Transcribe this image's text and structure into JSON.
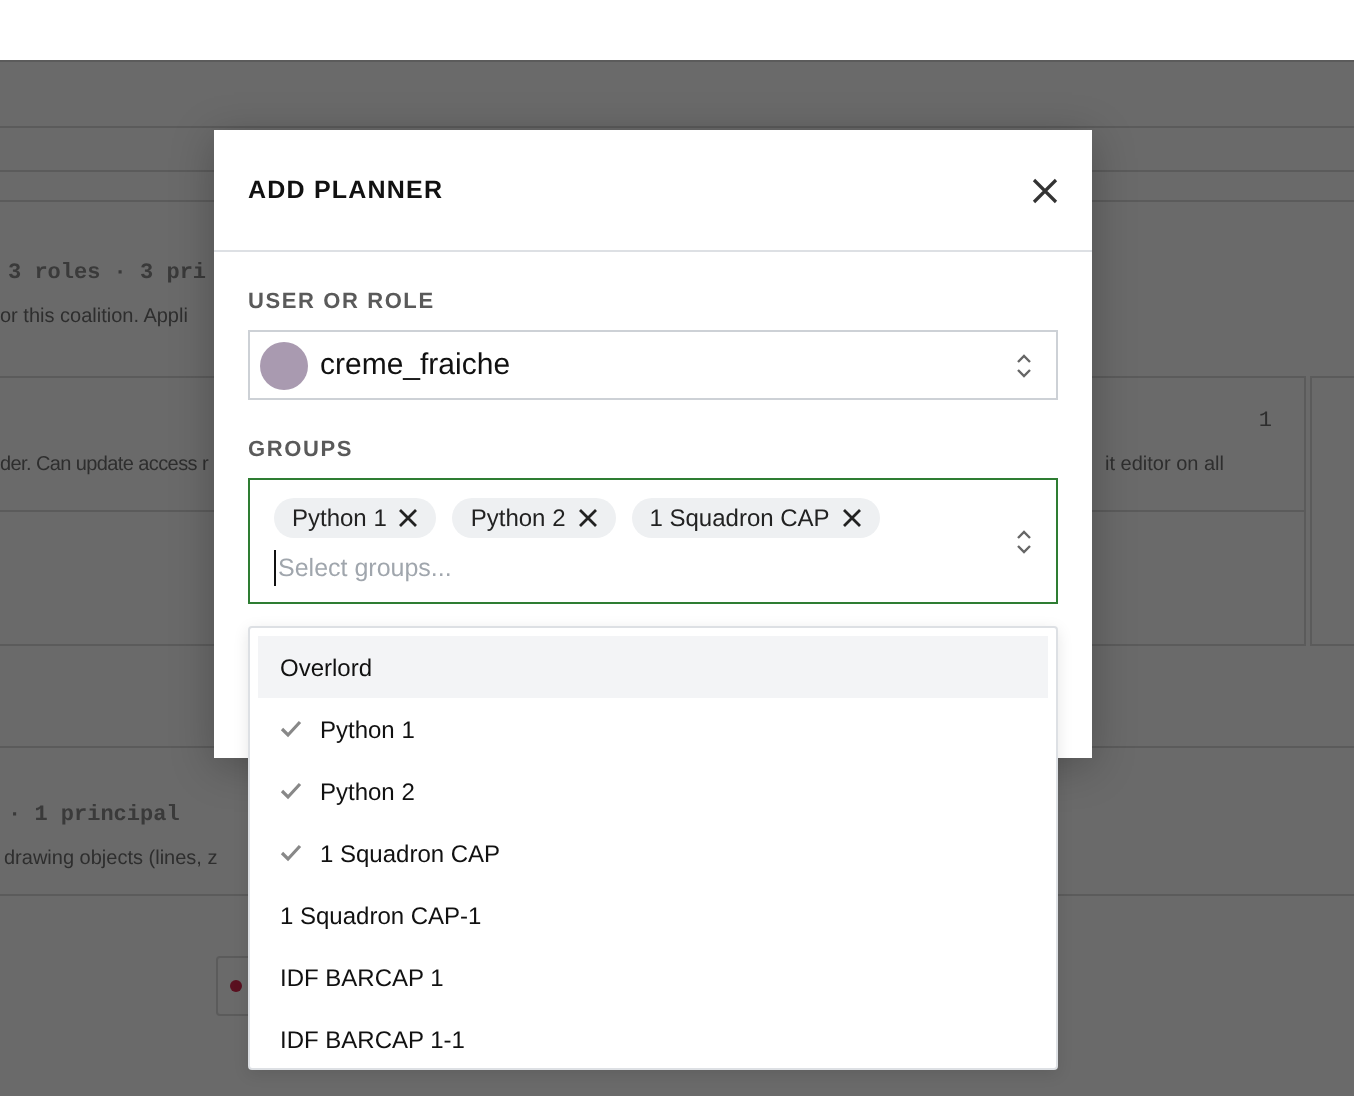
{
  "background": {
    "section_1": {
      "summary": "3 roles · 3 pri",
      "description": "or this coalition. Appli"
    },
    "card": {
      "description_left": "der. Can update access r",
      "count": "1",
      "description_right": "it editor on all"
    },
    "section_2": {
      "summary": "· 1 principal",
      "description": "drawing objects (lines, z"
    }
  },
  "modal": {
    "title": "ADD PLANNER",
    "user_label": "USER OR ROLE",
    "user_value": "creme_fraiche",
    "groups_label": "GROUPS",
    "chips": [
      {
        "label": "Python 1"
      },
      {
        "label": "Python 2"
      },
      {
        "label": "1 Squadron CAP"
      }
    ],
    "placeholder": "Select groups...",
    "options": [
      {
        "label": "Overlord",
        "selected": false,
        "highlighted": true
      },
      {
        "label": "Python 1",
        "selected": true,
        "highlighted": false
      },
      {
        "label": "Python 2",
        "selected": true,
        "highlighted": false
      },
      {
        "label": "1 Squadron CAP",
        "selected": true,
        "highlighted": false
      },
      {
        "label": "1 Squadron CAP-1",
        "selected": false,
        "highlighted": false
      },
      {
        "label": "IDF BARCAP 1",
        "selected": false,
        "highlighted": false
      },
      {
        "label": "IDF BARCAP 1-1",
        "selected": false,
        "highlighted": false
      }
    ]
  }
}
